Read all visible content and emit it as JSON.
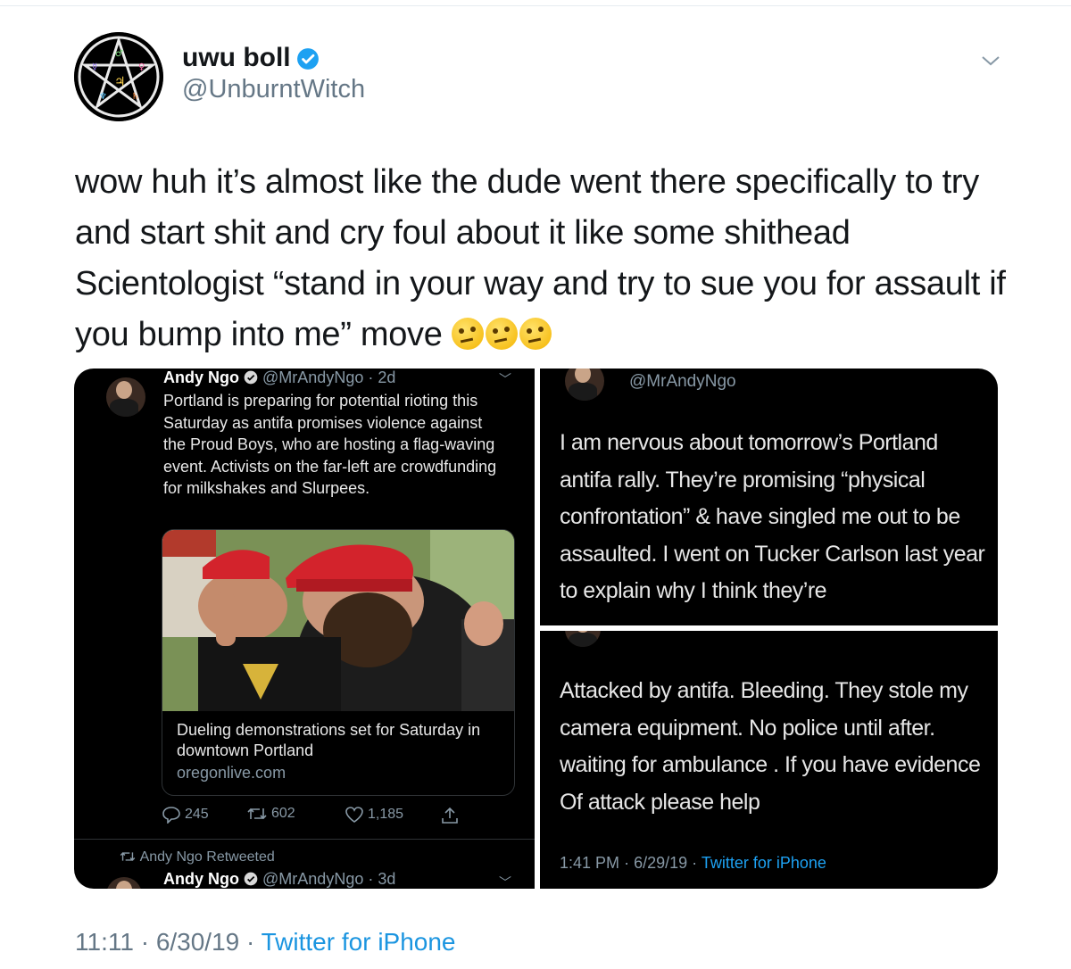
{
  "tweet": {
    "display_name": "uwu boll",
    "handle": "@UnburntWitch",
    "text": "wow huh it’s almost like the dude went there specifically to try and start shit and cry foul about it like some shithead Scientologist “stand in your way and try to sue you for assault if you bump into me” move",
    "emoji": [
      "thinking-face",
      "thinking-face",
      "thinking-face"
    ],
    "time": "11:11",
    "dot": "·",
    "date": "6/30/19",
    "source": "Twitter for iPhone"
  },
  "embedded_left": {
    "name": "Andy Ngo",
    "handle_time": "@MrAndyNgo · 2d",
    "text": "Portland is preparing for potential rioting this Saturday as antifa promises violence against the Proud Boys, who are hosting a flag-waving event. Activists on the far-left are crowdfunding for milkshakes and Slurpees.",
    "card_title": "Dueling demonstrations set for Saturday in downtown Portland",
    "card_domain": "oregonlive.com",
    "replies": "245",
    "retweets": "602",
    "likes": "1,185",
    "retweeted_label": "Andy Ngo Retweeted",
    "next_name": "Andy Ngo",
    "next_handle_time": "@MrAndyNgo · 3d"
  },
  "embedded_top_right": {
    "handle": "@MrAndyNgo",
    "text": "I am nervous about tomorrow’s Portland antifa rally. They’re promising “physical confrontation” & have singled me out to be assaulted. I went on Tucker Carlson last year to explain why I think they’re"
  },
  "embedded_bottom_right": {
    "text": "Attacked by antifa. Bleeding. They stole my camera equipment. No police until after. waiting for ambulance . If you have evidence Of attack please help",
    "time": "1:41 PM",
    "dot": "·",
    "date": "6/29/19",
    "source": "Twitter for iPhone"
  },
  "colors": {
    "link": "#1b95e0",
    "verified": "#1da1f2",
    "muted": "#657786"
  }
}
